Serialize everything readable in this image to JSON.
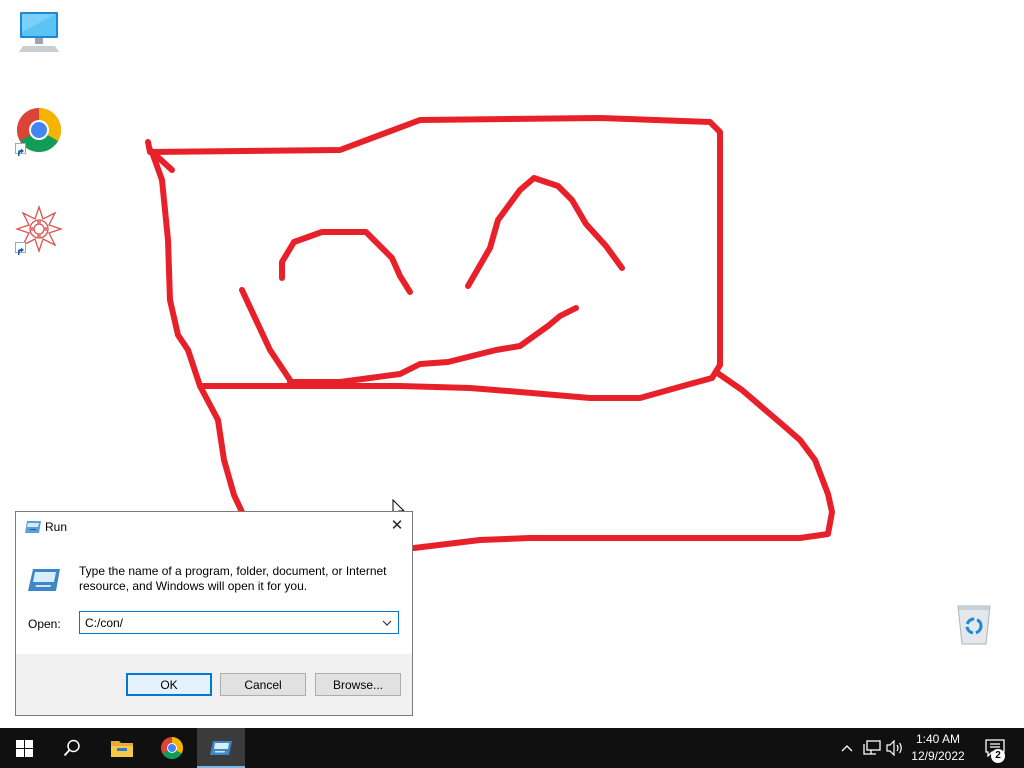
{
  "desktop": {
    "icons": [
      {
        "name": "This PC",
        "icon": "computer-icon"
      },
      {
        "name": "Google Chrome",
        "icon": "chrome-icon"
      },
      {
        "name": "Paint app",
        "icon": "paint-app-icon"
      },
      {
        "name": "Recycle Bin",
        "icon": "recycle-bin-icon"
      }
    ],
    "drawing_color": "#e8202a"
  },
  "run_dialog": {
    "title": "Run",
    "close_glyph": "✕",
    "description": "Type the name of a program, folder, document, or Internet resource, and Windows will open it for you.",
    "open_label": "Open:",
    "open_value": "C:/con/",
    "ok_label": "OK",
    "cancel_label": "Cancel",
    "browse_label": "Browse..."
  },
  "taskbar": {
    "items": [
      "start-icon",
      "search-icon",
      "file-explorer-icon",
      "chrome-icon",
      "run-icon"
    ],
    "active_item": "run-icon",
    "tray_icons": [
      "chevron-up-icon",
      "network-icon",
      "volume-icon"
    ],
    "clock": {
      "time": "1:40 AM",
      "date": "12/9/2022"
    },
    "notification_count": "2"
  }
}
